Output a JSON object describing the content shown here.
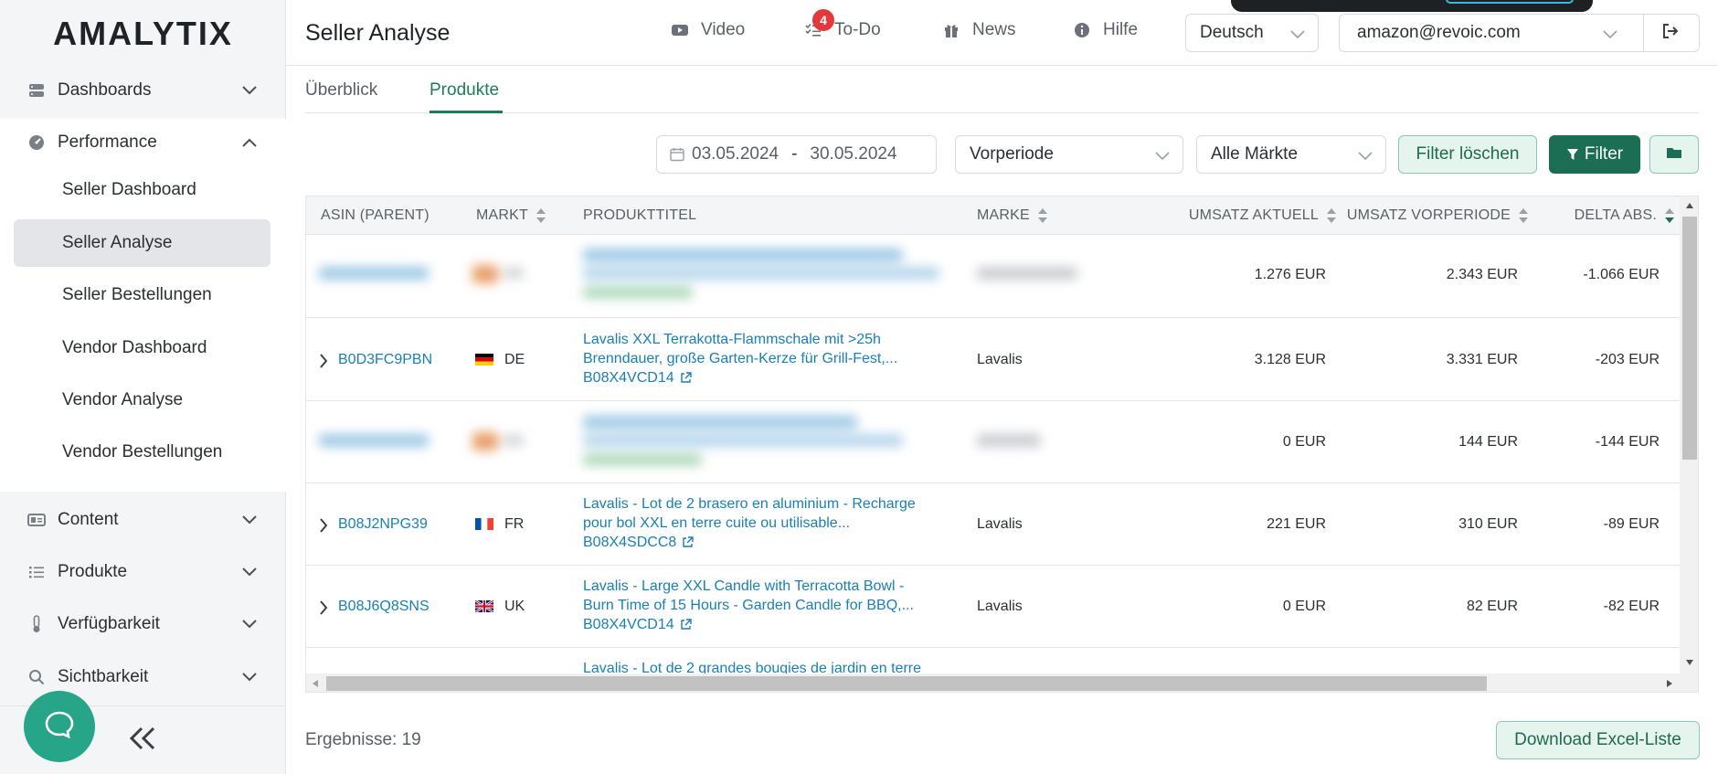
{
  "app": {
    "logo": "AMALYTIX",
    "page_title": "Seller Analyse"
  },
  "sidebar": {
    "groups": [
      {
        "label": "Dashboards",
        "icon": "server-icon",
        "expanded": false
      },
      {
        "label": "Performance",
        "icon": "gauge-icon",
        "expanded": true
      },
      {
        "label": "Content",
        "icon": "id-card-icon",
        "expanded": false
      },
      {
        "label": "Produkte",
        "icon": "list-icon",
        "expanded": false
      },
      {
        "label": "Verfügbarkeit",
        "icon": "thermometer-icon",
        "expanded": false
      },
      {
        "label": "Sichtbarkeit",
        "icon": "search-icon",
        "expanded": false
      }
    ],
    "performance_items": [
      {
        "label": "Seller Dashboard",
        "active": false
      },
      {
        "label": "Seller Analyse",
        "active": true
      },
      {
        "label": "Seller Bestellungen",
        "active": false
      },
      {
        "label": "Vendor Dashboard",
        "active": false
      },
      {
        "label": "Vendor Analyse",
        "active": false
      },
      {
        "label": "Vendor Bestellungen",
        "active": false
      }
    ]
  },
  "header": {
    "links": [
      {
        "label": "Video",
        "icon": "video-icon"
      },
      {
        "label": "To-Do",
        "icon": "checklist-icon",
        "badge": "4"
      },
      {
        "label": "News",
        "icon": "gift-icon"
      },
      {
        "label": "Hilfe",
        "icon": "info-icon"
      }
    ],
    "language": "Deutsch",
    "account": "amazon@revoic.com"
  },
  "tabs": [
    {
      "label": "Überblick",
      "active": false
    },
    {
      "label": "Produkte",
      "active": true
    }
  ],
  "filters": {
    "date_from": "03.05.2024",
    "date_sep": "-",
    "date_to": "30.05.2024",
    "comparison": "Vorperiode",
    "markets": "Alle Märkte",
    "clear_label": "Filter löschen",
    "filter_label": "Filter"
  },
  "table": {
    "columns": [
      "ASIN (PARENT)",
      "MARKT",
      "PRODUKTTITEL",
      "MARKE",
      "UMSATZ AKTUELL",
      "UMSATZ VORPERIODE",
      "DELTA ABS."
    ],
    "rows": [
      {
        "blurred": true,
        "umsatz_aktuell": "1.276 EUR",
        "umsatz_vorperiode": "2.343 EUR",
        "delta": "-1.066 EUR"
      },
      {
        "blurred": false,
        "asin": "B0D3FC9PBN",
        "market": "DE",
        "title_line1": "Lavalis XXL Terrakotta-Flammschale mit >25h",
        "title_line2": "Brenndauer, große Garten-Kerze für Grill-Fest,...",
        "child_asin": "B08X4VCD14",
        "brand": "Lavalis",
        "umsatz_aktuell": "3.128 EUR",
        "umsatz_vorperiode": "3.331 EUR",
        "delta": "-203 EUR"
      },
      {
        "blurred": true,
        "umsatz_aktuell": "0 EUR",
        "umsatz_vorperiode": "144 EUR",
        "delta": "-144 EUR"
      },
      {
        "blurred": false,
        "asin": "B08J2NPG39",
        "market": "FR",
        "title_line1": "Lavalis - Lot de 2 brasero en aluminium - Recharge",
        "title_line2": "pour bol XXL en terre cuite ou utilisable...",
        "child_asin": "B08X4SDCC8",
        "brand": "Lavalis",
        "umsatz_aktuell": "221 EUR",
        "umsatz_vorperiode": "310 EUR",
        "delta": "-89 EUR"
      },
      {
        "blurred": false,
        "asin": "B08J6Q8SNS",
        "market": "UK",
        "title_line1": "Lavalis - Large XXL Candle with Terracotta Bowl -",
        "title_line2": "Burn Time of 15 Hours - Garden Candle for BBQ,...",
        "child_asin": "B08X4VCD14",
        "brand": "Lavalis",
        "umsatz_aktuell": "0 EUR",
        "umsatz_vorperiode": "82 EUR",
        "delta": "-82 EUR"
      },
      {
        "blurred": false,
        "partial": true,
        "title_line1": "Lavalis - Lot de 2 grandes bougies de jardin en terre"
      }
    ]
  },
  "footer": {
    "results": "Ergebnisse: 19",
    "download_label": "Download Excel-Liste"
  },
  "colors": {
    "accent": "#1b6e53",
    "link": "#1a7fb5",
    "badge": "#e5383b",
    "chat": "#27a589"
  }
}
